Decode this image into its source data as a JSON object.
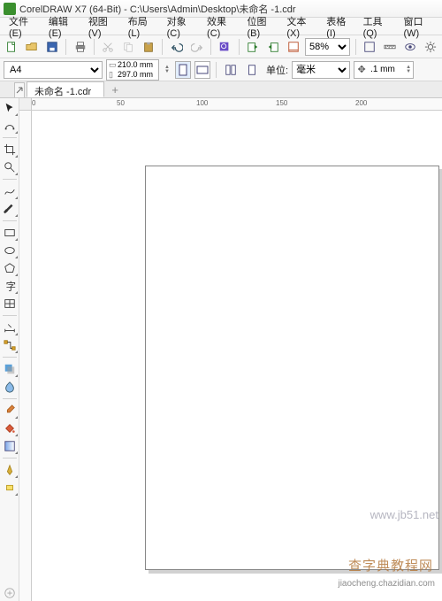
{
  "title": "CorelDRAW X7 (64-Bit) - C:\\Users\\Admin\\Desktop\\未命名 -1.cdr",
  "menu": [
    "文件(E)",
    "编辑(E)",
    "视图(V)",
    "布局(L)",
    "对象(C)",
    "效果(C)",
    "位图(B)",
    "文本(X)",
    "表格(I)",
    "工具(Q)",
    "窗口(W)"
  ],
  "toolbar": {
    "zoom_value": "58%"
  },
  "propbar": {
    "paper": "A4",
    "width": "210.0 mm",
    "height": "297.0 mm",
    "units_label": "单位:",
    "units_value": "毫米",
    "nudge": ".1 mm"
  },
  "tabs": {
    "name": "未命名 -1.cdr"
  },
  "ruler": {
    "h_labels": [
      "0",
      "50",
      "100",
      "150",
      "200"
    ]
  },
  "watermarks": {
    "site1": "www.jb51.net",
    "site2": "查字典教程网",
    "site3": "jiaocheng.chazidian.com"
  }
}
